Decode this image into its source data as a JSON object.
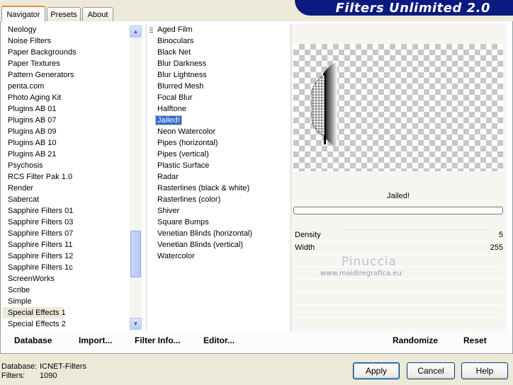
{
  "tabs": [
    "Navigator",
    "Presets",
    "About"
  ],
  "banner": "Filters Unlimited 2.0",
  "categories": [
    "Neology",
    "Noise Filters",
    "Paper Backgrounds",
    "Paper Textures",
    "Pattern Generators",
    "penta.com",
    "Photo Aging Kit",
    "Plugins AB 01",
    "Plugins AB 07",
    "Plugins AB 09",
    "Plugins AB 10",
    "Plugins AB 21",
    "Psychosis",
    "RCS Filter Pak 1.0",
    "Render",
    "Sabercat",
    "Sapphire Filters 01",
    "Sapphire Filters 03",
    "Sapphire Filters 07",
    "Sapphire Filters 11",
    "Sapphire Filters 12",
    "Sapphire Filters 1c",
    "ScreenWorks",
    "Scribe",
    "Simple",
    "Special Effects 1",
    "Special Effects 2"
  ],
  "selected_category": "Special Effects 1",
  "filters": [
    "Aged Film",
    "Binoculars",
    "Black Net",
    "Blur Darkness",
    "Blur Lightness",
    "Blurred Mesh",
    "Focal Blur",
    "Halftone",
    "Jailed!",
    "Neon Watercolor",
    "Pipes (horizontal)",
    "Pipes (vertical)",
    "Plastic Surface",
    "Radar",
    "Rasterlines (black & white)",
    "Rasterlines (color)",
    "Shiver",
    "Square Bumps",
    "Venetian Blinds (horizontal)",
    "Venetian Blinds (vertical)",
    "Watercolor"
  ],
  "selected_filter": "Jailed!",
  "filter_name": "Jailed!",
  "params": [
    {
      "label": "Density",
      "value": "5"
    },
    {
      "label": "Width",
      "value": "255"
    }
  ],
  "watermark": "Pinuccia",
  "watermark_url": "www.maidiregrafica.eu",
  "bottom": {
    "database": "Database",
    "import": "Import...",
    "filter_info": "Filter Info...",
    "editor": "Editor...",
    "randomize": "Randomize",
    "reset": "Reset"
  },
  "status": {
    "db_label": "Database:",
    "db_value": "ICNET-Filters",
    "filters_label": "Filters:",
    "filters_value": "1090"
  },
  "buttons": {
    "apply": "Apply",
    "cancel": "Cancel",
    "help": "Help"
  },
  "icons": {
    "scroll_up": "arrow-up-icon",
    "scroll_down": "arrow-down-icon"
  }
}
